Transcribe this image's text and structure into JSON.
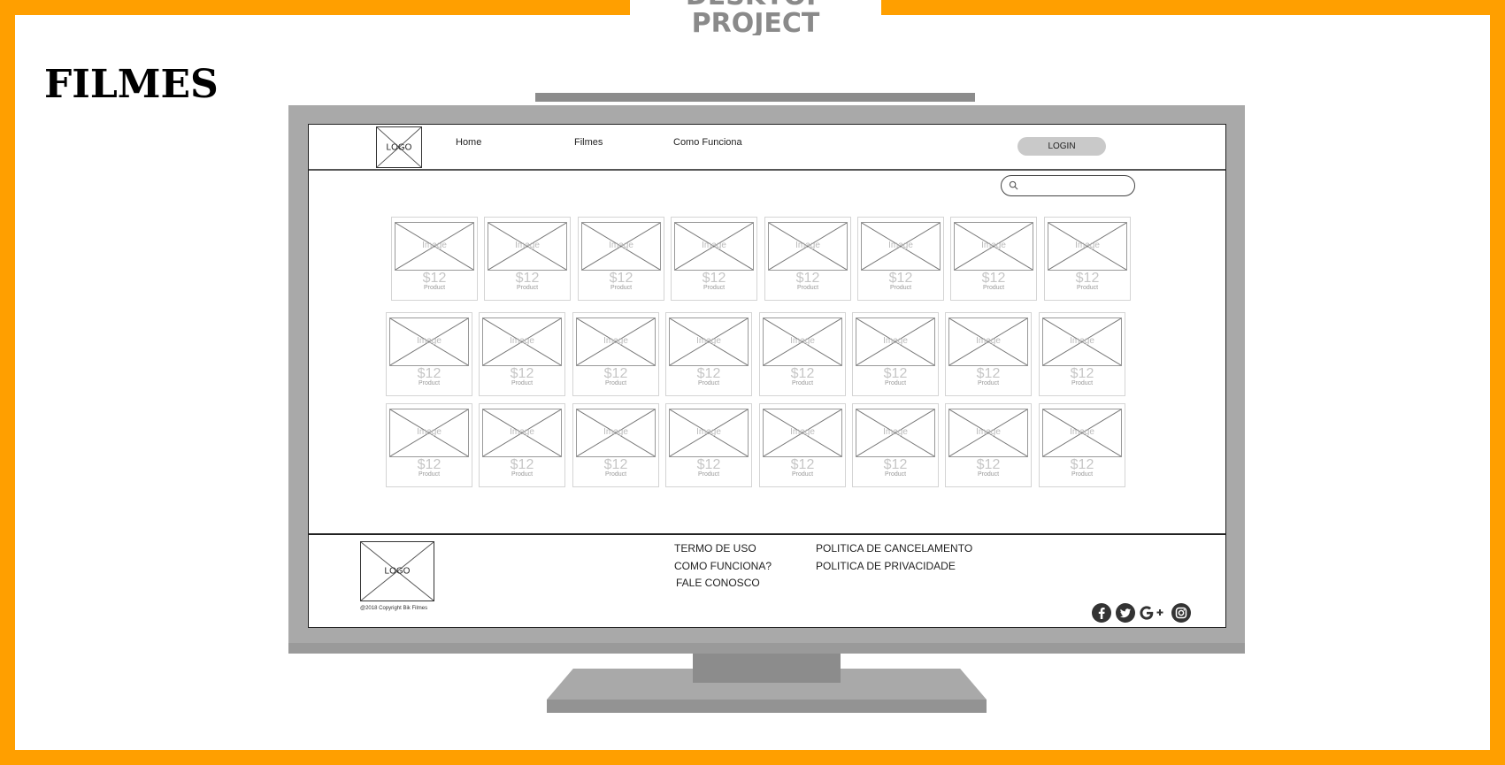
{
  "slide": {
    "tab_label_top": "DESKTOP",
    "tab_label_bottom": "PROJECT",
    "title": "FILMES"
  },
  "site": {
    "nav": {
      "logo": "LOGO",
      "links": [
        "Home",
        "Filmes",
        "Como Funciona"
      ],
      "login": "LOGIN"
    },
    "search": {
      "placeholder": ""
    },
    "products": [
      [
        {
          "image": "Image",
          "price": "$12",
          "name": "Product"
        },
        {
          "image": "Image",
          "price": "$12",
          "name": "Product"
        },
        {
          "image": "Image",
          "price": "$12",
          "name": "Product"
        },
        {
          "image": "Image",
          "price": "$12",
          "name": "Product"
        },
        {
          "image": "Image",
          "price": "$12",
          "name": "Product"
        },
        {
          "image": "Image",
          "price": "$12",
          "name": "Product"
        },
        {
          "image": "Image",
          "price": "$12",
          "name": "Product"
        },
        {
          "image": "Image",
          "price": "$12",
          "name": "Product"
        }
      ],
      [
        {
          "image": "Image",
          "price": "$12",
          "name": "Product"
        },
        {
          "image": "Image",
          "price": "$12",
          "name": "Product"
        },
        {
          "image": "Image",
          "price": "$12",
          "name": "Product"
        },
        {
          "image": "Image",
          "price": "$12",
          "name": "Product"
        },
        {
          "image": "Image",
          "price": "$12",
          "name": "Product"
        },
        {
          "image": "Image",
          "price": "$12",
          "name": "Product"
        },
        {
          "image": "Image",
          "price": "$12",
          "name": "Product"
        },
        {
          "image": "Image",
          "price": "$12",
          "name": "Product"
        }
      ],
      [
        {
          "image": "Image",
          "price": "$12",
          "name": "Product"
        },
        {
          "image": "Image",
          "price": "$12",
          "name": "Product"
        },
        {
          "image": "Image",
          "price": "$12",
          "name": "Product"
        },
        {
          "image": "Image",
          "price": "$12",
          "name": "Product"
        },
        {
          "image": "Image",
          "price": "$12",
          "name": "Product"
        },
        {
          "image": "Image",
          "price": "$12",
          "name": "Product"
        },
        {
          "image": "Image",
          "price": "$12",
          "name": "Product"
        },
        {
          "image": "Image",
          "price": "$12",
          "name": "Product"
        }
      ]
    ],
    "footer": {
      "logo": "LOGO",
      "copyright": "@2018 Copyright Bik Filmes",
      "links_col1": [
        "TERMO DE USO",
        "COMO FUNCIONA?",
        "FALE CONOSCO"
      ],
      "links_col2": [
        "POLITICA DE CANCELAMENTO",
        "POLITICA DE PRIVACIDADE"
      ],
      "social_icons": [
        "facebook-icon",
        "twitter-icon",
        "google-plus-icon",
        "instagram-icon"
      ]
    }
  },
  "colors": {
    "accent_border": "#ff9f00",
    "monitor_gray": "#a9a9a9",
    "button_gray": "#c9c9c9"
  }
}
